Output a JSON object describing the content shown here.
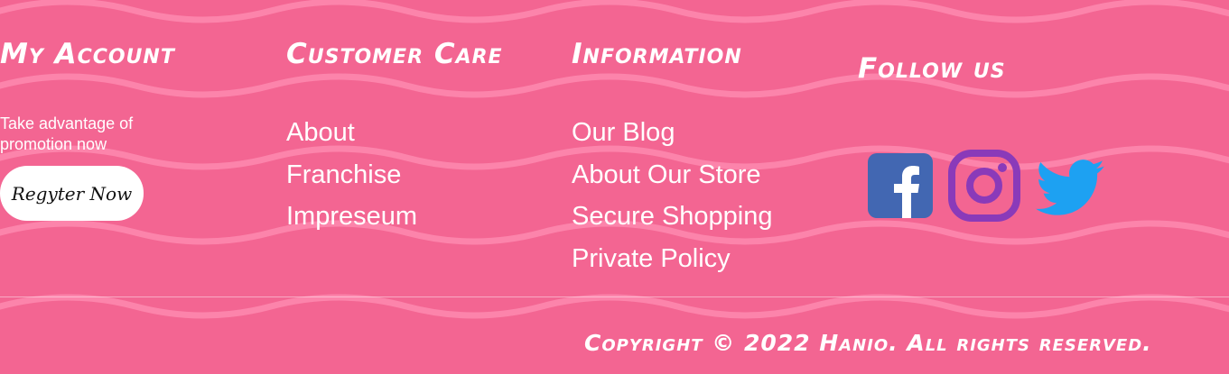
{
  "colors": {
    "background": "#f36592",
    "wave": "#ff8fb4",
    "text": "#ffffff"
  },
  "my_account": {
    "heading": "My Account",
    "promo_text": "Take advantage of promotion now",
    "register_label": "Regyter Now"
  },
  "customer_care": {
    "heading": "Customer Care",
    "links": [
      {
        "label": "About"
      },
      {
        "label": "Franchise"
      },
      {
        "label": "Impreseum"
      }
    ]
  },
  "information": {
    "heading": "Information",
    "links": [
      {
        "label": "Our Blog"
      },
      {
        "label": "About Our Store"
      },
      {
        "label": "Secure Shopping"
      },
      {
        "label": "Private Policy"
      }
    ]
  },
  "follow_us": {
    "heading": "Follow us",
    "icons": [
      {
        "name": "facebook-icon",
        "color": "#4267b2"
      },
      {
        "name": "instagram-icon",
        "color": "#8a3ab9"
      },
      {
        "name": "twitter-icon",
        "color": "#1da1f2"
      }
    ]
  },
  "footer": {
    "copyright": "Copyright © 2022 Hanio. All rights reserved."
  }
}
